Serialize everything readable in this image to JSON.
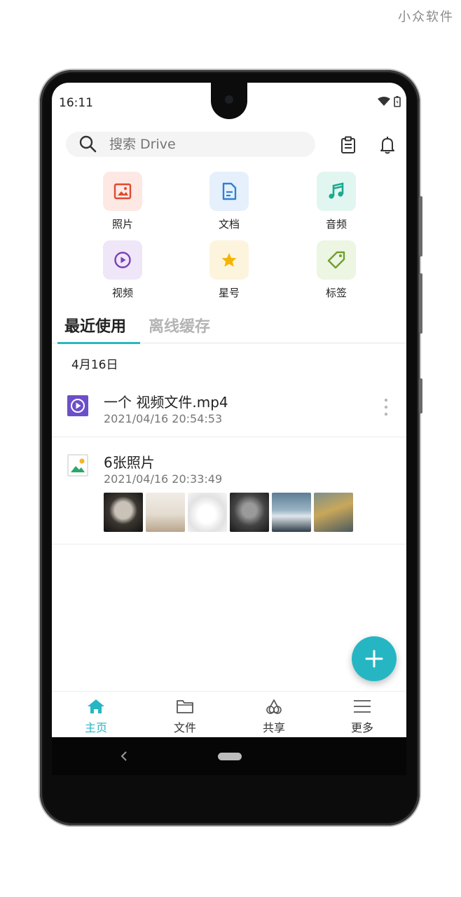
{
  "watermark": "小众软件",
  "status": {
    "time": "16:11"
  },
  "search": {
    "placeholder": "搜索 Drive"
  },
  "categories": [
    {
      "label": "照片",
      "icon": "image-icon",
      "color": "#e0492f",
      "bg": "#fde8e4"
    },
    {
      "label": "文档",
      "icon": "document-icon",
      "color": "#2f7fd6",
      "bg": "#e5f0fc"
    },
    {
      "label": "音频",
      "icon": "music-icon",
      "color": "#1bab8f",
      "bg": "#e2f6f1"
    },
    {
      "label": "视频",
      "icon": "play-icon",
      "color": "#7b3fb8",
      "bg": "#efe6f8"
    },
    {
      "label": "星号",
      "icon": "star-icon",
      "color": "#f5b400",
      "bg": "#fdf4dd"
    },
    {
      "label": "标签",
      "icon": "tag-icon",
      "color": "#6fa030",
      "bg": "#edf5e3"
    }
  ],
  "tabs": {
    "recent": "最近使用",
    "offline": "离线缓存"
  },
  "recent": {
    "date_header": "4月16日",
    "items": [
      {
        "title": "一个 视频文件.mp4",
        "time": "2021/04/16 20:54:53",
        "icon": "video-file-icon"
      },
      {
        "title": "6张照片",
        "time": "2021/04/16 20:33:49",
        "icon": "image-file-icon"
      }
    ]
  },
  "nav": [
    {
      "label": "主页",
      "icon": "home-icon",
      "active": true
    },
    {
      "label": "文件",
      "icon": "folder-icon",
      "active": false
    },
    {
      "label": "共享",
      "icon": "share-icon",
      "active": false
    },
    {
      "label": "更多",
      "icon": "menu-icon",
      "active": false
    }
  ],
  "colors": {
    "accent": "#26b6c3",
    "text": "#222222",
    "muted": "#777777"
  }
}
